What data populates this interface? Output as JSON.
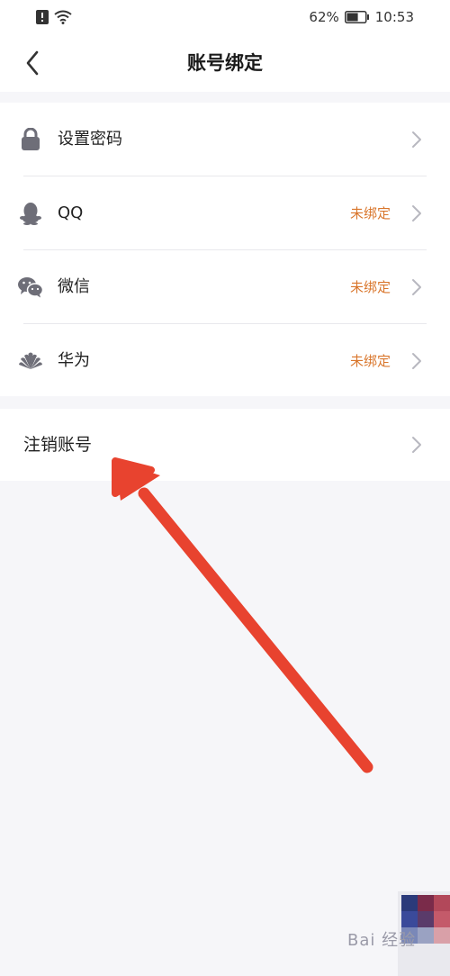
{
  "status_bar": {
    "battery_percent": "62%",
    "time": "10:53",
    "battery_level": 0.62
  },
  "nav": {
    "title": "账号绑定",
    "back_icon": "chevron-left-icon"
  },
  "bindings": [
    {
      "label": "设置密码",
      "status": "",
      "icon": "lock-icon"
    },
    {
      "label": "QQ",
      "status": "未绑定",
      "icon": "qq-icon"
    },
    {
      "label": "微信",
      "status": "未绑定",
      "icon": "wechat-icon"
    },
    {
      "label": "华为",
      "status": "未绑定",
      "icon": "huawei-icon"
    }
  ],
  "cancel_account": {
    "label": "注销账号"
  },
  "watermark": {
    "text": "Bai 经验"
  },
  "colors": {
    "status_accent": "#d9762c",
    "arrow": "#e8432f",
    "background": "#f6f6f9"
  }
}
